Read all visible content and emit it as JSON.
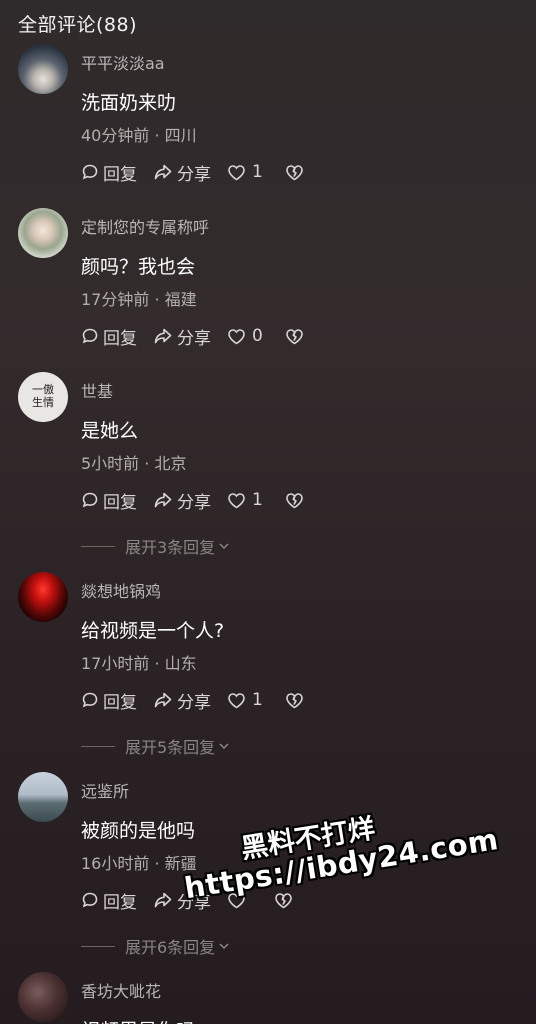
{
  "header": {
    "title": "全部评论(88)"
  },
  "comments": [
    {
      "username": "平平淡淡aa",
      "content": "洗面奶来叻",
      "meta": "40分钟前 · 四川",
      "reply_label": "回复",
      "share_label": "分享",
      "likes": "1",
      "expand_label": ""
    },
    {
      "username": "定制您的专属称呼",
      "content": "颜吗？我也会",
      "meta": "17分钟前 · 福建",
      "reply_label": "回复",
      "share_label": "分享",
      "likes": "0",
      "expand_label": ""
    },
    {
      "username": "世基",
      "content": "是她么",
      "meta": "5小时前 · 北京",
      "reply_label": "回复",
      "share_label": "分享",
      "likes": "1",
      "expand_label": "展开3条回复",
      "avatar_text": "一傲 生情"
    },
    {
      "username": "燚想地锅鸡",
      "content": "给视频是一个人?",
      "meta": "17小时前 · 山东",
      "reply_label": "回复",
      "share_label": "分享",
      "likes": "1",
      "expand_label": "展开5条回复"
    },
    {
      "username": "远鉴所",
      "content": "被颜的是他吗",
      "meta": "16小时前 · 新疆",
      "reply_label": "回复",
      "share_label": "分享",
      "likes": "",
      "expand_label": "展开6条回复"
    },
    {
      "username": "香坊大呲花",
      "content": "视频里是你吗",
      "meta": "",
      "reply_label": "",
      "share_label": "",
      "likes": "",
      "expand_label": ""
    }
  ],
  "watermark": {
    "line1": "黑料不打烊",
    "line2": "https://ibdy24.com"
  },
  "colors": {
    "text_primary": "#ffffff",
    "text_secondary": "#b3afaf",
    "background": "#2f2a2b"
  }
}
